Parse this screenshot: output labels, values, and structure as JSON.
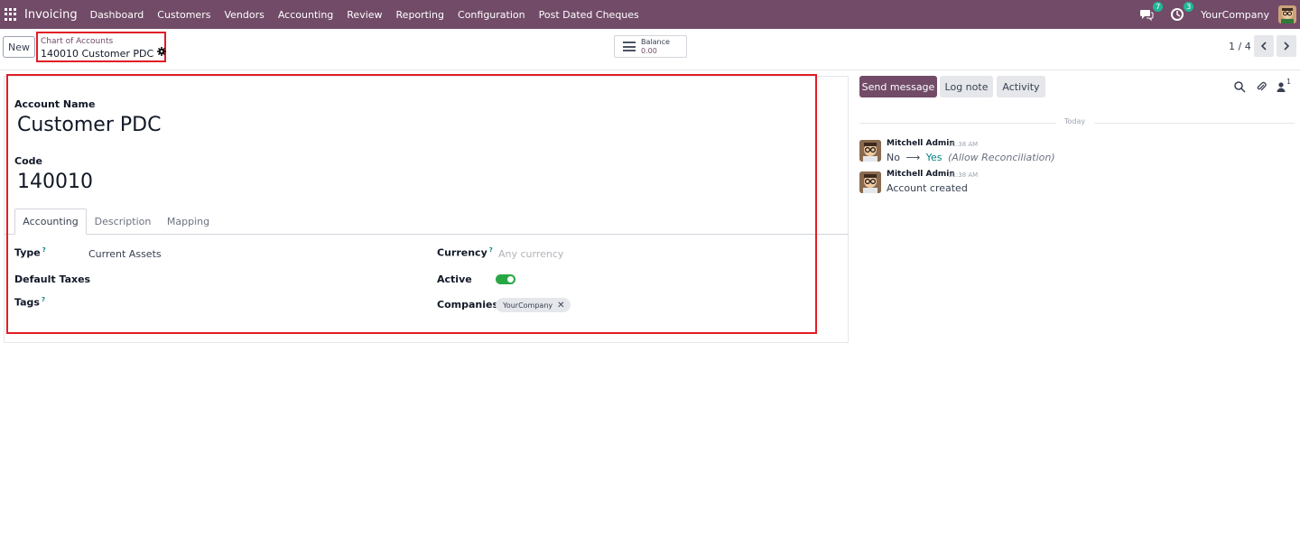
{
  "navbar": {
    "app_name": "Invoicing",
    "menu": [
      "Dashboard",
      "Customers",
      "Vendors",
      "Accounting",
      "Review",
      "Reporting",
      "Configuration",
      "Post Dated Cheques"
    ],
    "messages_count": "7",
    "activities_count": "3",
    "company": "YourCompany"
  },
  "control_panel": {
    "new_label": "New",
    "breadcrumb_parent": "Chart of Accounts",
    "breadcrumb_current": "140010 Customer PDC",
    "balance_label": "Balance",
    "balance_value": "0.00",
    "pager": "1 / 4"
  },
  "form": {
    "account_name_label": "Account Name",
    "account_name": "Customer PDC",
    "code_label": "Code",
    "code": "140010",
    "tabs": [
      "Accounting",
      "Description",
      "Mapping"
    ],
    "type_label": "Type",
    "type_value": "Current Assets",
    "default_taxes_label": "Default Taxes",
    "tags_label": "Tags",
    "currency_label": "Currency",
    "currency_placeholder": "Any currency",
    "active_label": "Active",
    "active": true,
    "companies_label": "Companies",
    "companies": [
      "YourCompany"
    ],
    "help_mark": "?"
  },
  "chatter": {
    "send_message": "Send message",
    "log_note": "Log note",
    "activity": "Activity",
    "followers_count": "1",
    "date_separator": "Today",
    "messages": [
      {
        "author": "Mitchell Admin",
        "time": "11:38 AM",
        "old_value": "No",
        "new_value": "Yes",
        "field": "(Allow Reconciliation)"
      },
      {
        "author": "Mitchell Admin",
        "time": "11:38 AM",
        "body": "Account created"
      }
    ]
  },
  "colors": {
    "brand": "#714b67",
    "accent": "#017e84",
    "toggle_on": "#28a745",
    "highlight": "#e11d26"
  }
}
